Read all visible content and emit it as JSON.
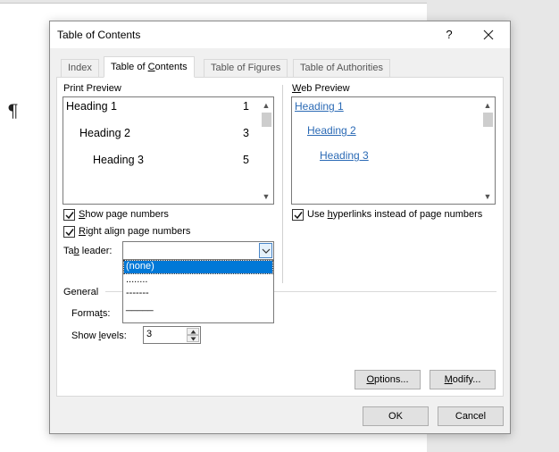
{
  "dialog": {
    "title": "Table of Contents",
    "help": "?",
    "tabs": [
      {
        "label": "Index"
      },
      {
        "label": "Table of Contents"
      },
      {
        "label": "Table of Figures"
      },
      {
        "label": "Table of Authorities"
      }
    ]
  },
  "print_preview": {
    "label": "Print Preview",
    "entries": [
      {
        "text": "Heading 1",
        "page": "1"
      },
      {
        "text": "Heading 2",
        "page": "3"
      },
      {
        "text": "Heading 3",
        "page": "5"
      }
    ]
  },
  "web_preview": {
    "label": "Web Preview",
    "links": [
      "Heading 1",
      "Heading 2",
      "Heading 3"
    ]
  },
  "options": {
    "show_page_numbers": {
      "pre": "",
      "key": "S",
      "post": "how page numbers",
      "checked": true
    },
    "right_align": {
      "pre": "",
      "key": "R",
      "post": "ight align page numbers",
      "checked": true
    },
    "use_hyperlinks": {
      "pre": "Use ",
      "key": "h",
      "post": "yperlinks instead of page numbers",
      "checked": true
    }
  },
  "tab_leader": {
    "label_pre": "Ta",
    "label_key": "b",
    "label_post": " leader:",
    "value": "",
    "options": [
      "(none)",
      "........",
      "-------",
      "_____"
    ],
    "selected_index": 0
  },
  "general": {
    "label": "General",
    "formats_pre": "Forma",
    "formats_key": "t",
    "formats_post": "s:",
    "show_levels_pre": "Show ",
    "show_levels_key": "l",
    "show_levels_post": "evels:",
    "show_levels_value": "3"
  },
  "buttons": {
    "options_pre": "",
    "options_key": "O",
    "options_post": "ptions...",
    "modify_pre": "",
    "modify_key": "M",
    "modify_post": "odify...",
    "ok": "OK",
    "cancel": "Cancel"
  },
  "document": {
    "pilcrow": "¶"
  }
}
